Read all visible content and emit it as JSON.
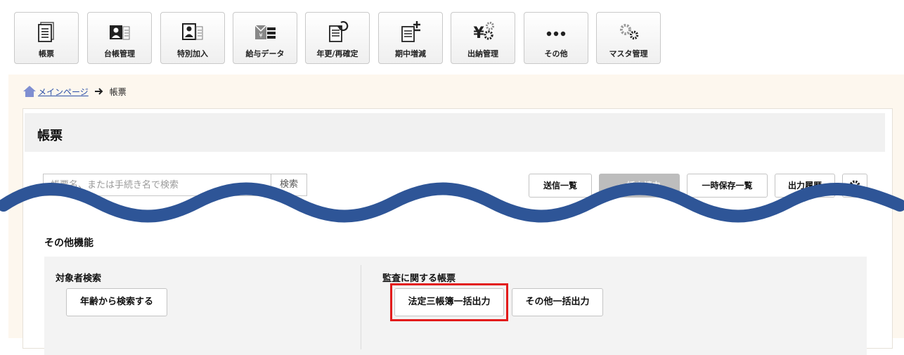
{
  "toolbar": {
    "items": [
      {
        "label": "帳票",
        "icon": "ledger-icon"
      },
      {
        "label": "台帳管理",
        "icon": "person-card-icon"
      },
      {
        "label": "特別加入",
        "icon": "special-person-icon"
      },
      {
        "label": "給与データ",
        "icon": "salary-data-icon"
      },
      {
        "label": "年更/再確定",
        "icon": "annual-update-icon"
      },
      {
        "label": "期中増減",
        "icon": "doc-plus-minus-icon"
      },
      {
        "label": "出納管理",
        "icon": "yen-gear-icon"
      },
      {
        "label": "その他",
        "icon": "more-dots-icon"
      },
      {
        "label": "マスタ管理",
        "icon": "gears-icon"
      }
    ]
  },
  "breadcrumb": {
    "home_link": "メインページ",
    "current": "帳票"
  },
  "page": {
    "title": "帳票"
  },
  "search": {
    "placeholder": "帳票名、または手続き名で検索",
    "button": "検索"
  },
  "actions": {
    "list": "送信一覧",
    "bulk": "一括申請中",
    "temp_save": "一時保存一覧",
    "history": "出力履歴"
  },
  "other_functions": {
    "title": "その他機能",
    "target_search": {
      "title": "対象者検索",
      "button": "年齢から検索する"
    },
    "audit": {
      "title": "監査に関する帳票",
      "button_legal": "法定三帳簿一括出力",
      "button_other": "その他一括出力"
    }
  },
  "colors": {
    "accent": "#2b4fa8",
    "wave": "#2e5597",
    "highlight": "#e31b1b",
    "background": "#fdf7ee"
  }
}
